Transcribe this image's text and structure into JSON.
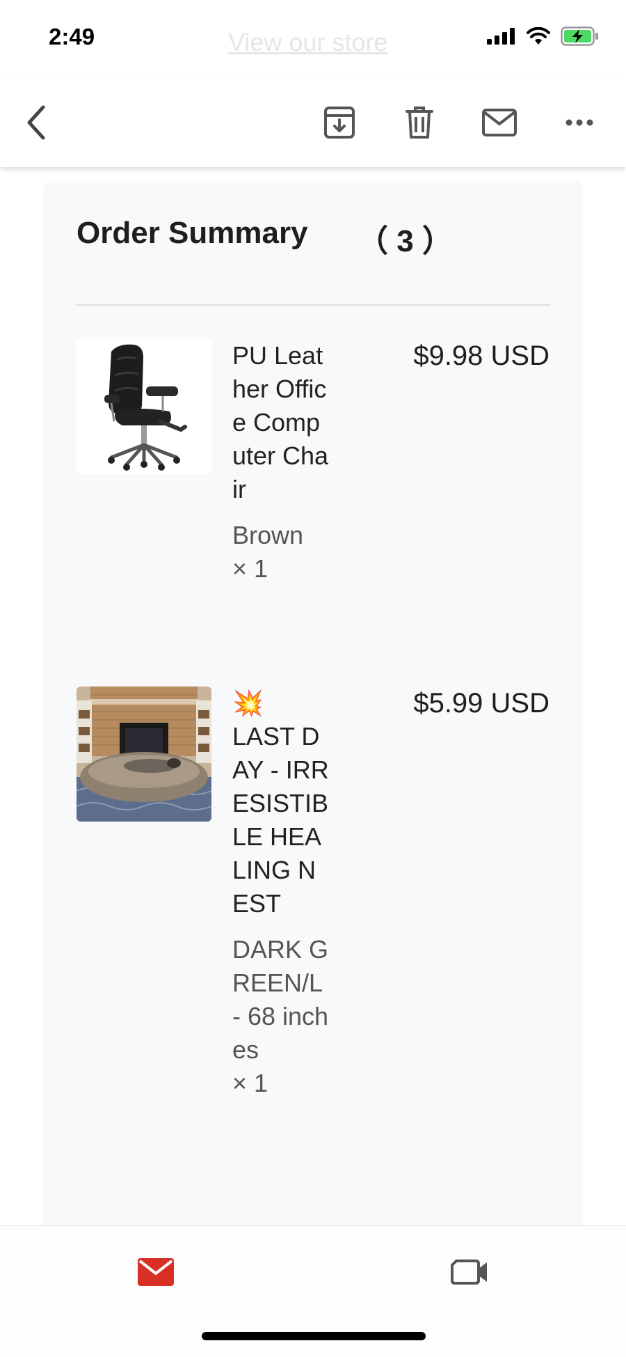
{
  "status_bar": {
    "time": "2:49",
    "background_link_text": "View our store",
    "icons": [
      "cellular-signal-icon",
      "wifi-icon",
      "battery-charging-icon"
    ]
  },
  "toolbar": {
    "icons": [
      "back-chevron-icon",
      "archive-icon",
      "trash-icon",
      "mail-icon",
      "more-icon"
    ]
  },
  "order_summary": {
    "title": "Order Summary",
    "count": "（ 3 ）",
    "items": [
      {
        "name": "PU Leather Office Computer Chair",
        "variant": "Brown",
        "quantity": "× 1",
        "price": "$9.98 USD",
        "image": "black-leather-office-chair"
      },
      {
        "emoji": "💥",
        "name": "LAST DAY - IRRESISTIBLE HEALING NEST",
        "variant": "DARK GREEN/L - 68 inches",
        "quantity": "× 1",
        "price": "$5.99 USD",
        "image": "fur-bed-by-fireplace"
      }
    ]
  },
  "bottom_bar": {
    "icons": [
      "mail-tab-icon",
      "video-tab-icon"
    ],
    "accent_color": "#d93025"
  }
}
